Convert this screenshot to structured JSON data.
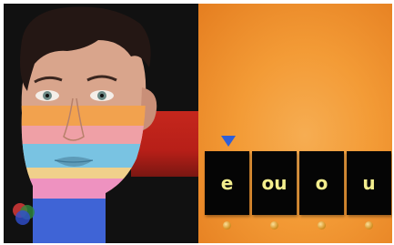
{
  "tiles": [
    {
      "label": "e"
    },
    {
      "label": "ou"
    },
    {
      "label": "o"
    },
    {
      "label": "u"
    }
  ],
  "colors": {
    "panel": "#f39b36",
    "tile": "#050505",
    "tile_text": "#f3ee8e",
    "marker": "#2f5fd8",
    "red_band": "#c5271d"
  },
  "icons": {
    "marker": "down-triangle-icon",
    "pegs": "peg-icon",
    "logo": "rgb-circles-logo"
  }
}
